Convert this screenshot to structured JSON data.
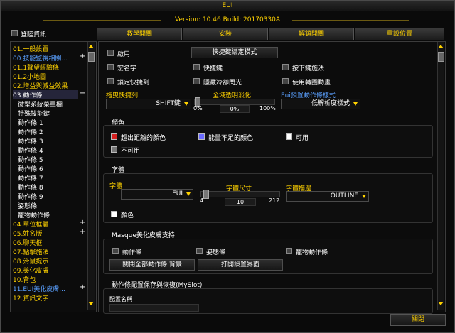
{
  "window": {
    "title": "EUI",
    "version": "Version: 10.46 Build: 20170330A"
  },
  "login_info": {
    "label": "登陸資訊"
  },
  "tabs": [
    "教學開關",
    "安裝",
    "解鎖開關",
    "重設位置"
  ],
  "sidebar": {
    "items": [
      {
        "label": "01.一般設置",
        "color": "#ffd200"
      },
      {
        "label": "00.技能監視相關...",
        "color": "#5aa0ff",
        "expand": "+"
      },
      {
        "label": "01.1聲望經驗條",
        "color": "#ffd200"
      },
      {
        "label": "01.2小地圖",
        "color": "#ffd200"
      },
      {
        "label": "02.增益與減益效果",
        "color": "#ffd200"
      },
      {
        "label": "03.動作條",
        "color": "#ffffff",
        "expand": "−",
        "selected": true
      },
      {
        "label": "微型系統菜單欄",
        "color": "#ffffff",
        "sub": true
      },
      {
        "label": "特殊技能鍵",
        "color": "#ffffff",
        "sub": true
      },
      {
        "label": "動作條 1",
        "color": "#ffffff",
        "sub": true
      },
      {
        "label": "動作條 2",
        "color": "#ffffff",
        "sub": true
      },
      {
        "label": "動作條 3",
        "color": "#ffffff",
        "sub": true
      },
      {
        "label": "動作條 4",
        "color": "#ffffff",
        "sub": true
      },
      {
        "label": "動作條 5",
        "color": "#ffffff",
        "sub": true
      },
      {
        "label": "動作條 6",
        "color": "#ffffff",
        "sub": true
      },
      {
        "label": "動作條 7",
        "color": "#ffffff",
        "sub": true
      },
      {
        "label": "動作條 8",
        "color": "#ffffff",
        "sub": true
      },
      {
        "label": "動作條 9",
        "color": "#ffffff",
        "sub": true
      },
      {
        "label": "姿態條",
        "color": "#ffffff",
        "sub": true
      },
      {
        "label": "寵物動作條",
        "color": "#ffffff",
        "sub": true
      },
      {
        "label": "04.單位框體",
        "color": "#ffd200",
        "expand": "+"
      },
      {
        "label": "05.姓名版",
        "color": "#ffd200",
        "expand": "+"
      },
      {
        "label": "06.聊天框",
        "color": "#ffd200"
      },
      {
        "label": "07.點擊施法",
        "color": "#ffd200"
      },
      {
        "label": "08.滑鼠提示",
        "color": "#ffd200"
      },
      {
        "label": "09.美化皮膚",
        "color": "#ffd200"
      },
      {
        "label": "10.背包",
        "color": "#ffd200"
      },
      {
        "label": "11.EUI美化皮膚...",
        "color": "#5aa0ff",
        "expand": "+"
      },
      {
        "label": "12.資訊文字",
        "color": "#ffd200"
      }
    ]
  },
  "main": {
    "enable": "啟用",
    "keybind_mode_button": "快捷鍵綁定模式",
    "macro_name": "宏名字",
    "hotkey": "快捷鍵",
    "press_cast": "按下鍵施法",
    "lock_bars": "鎖定快捷列",
    "hide_cd_flash": "隱藏冷卻閃光",
    "use_turn_anim": "使用轉圈動畫",
    "drag_hotkey": {
      "label": "拖曳快捷列",
      "value": "SHIFT鍵"
    },
    "global_alpha": {
      "label": "全域透明淡化",
      "min": "0%",
      "value": "0%",
      "max": "100%",
      "level": 0
    },
    "preset_label": "Eui預置動作條樣式",
    "preset_value": "低解析度樣式",
    "colors": {
      "title": "顏色",
      "out_of_range": {
        "label": "超出距離的顏色",
        "color": "#d42020"
      },
      "no_power": {
        "label": "能量不足的顏色",
        "color": "#6a6aff"
      },
      "usable": {
        "label": "可用",
        "color": "#ffffff"
      },
      "unusable": {
        "label": "不可用",
        "color": "#777777"
      }
    },
    "font": {
      "title": "字體",
      "font_label": "字體",
      "font_value": "EUI",
      "size_label": "字體尺寸",
      "size_min": "4",
      "size_value": "10",
      "size_max": "212",
      "outline_label": "字體描邊",
      "outline_value": "OUTLINE",
      "color_label": "顏色",
      "color": "#ffffff"
    },
    "masque": {
      "title": "Masque美化皮膚支持",
      "action_bar": "動作條",
      "stance_bar": "姿態條",
      "pet_bar": "寵物動作條",
      "disable_bg_button": "關閉全部動作條 背景",
      "open_settings_button": "打開設置界面"
    },
    "myslot": {
      "title": "動作條配置保存與恢復(MySlot)",
      "config_name_label": "配置名稱"
    }
  },
  "close_button": "關閉"
}
